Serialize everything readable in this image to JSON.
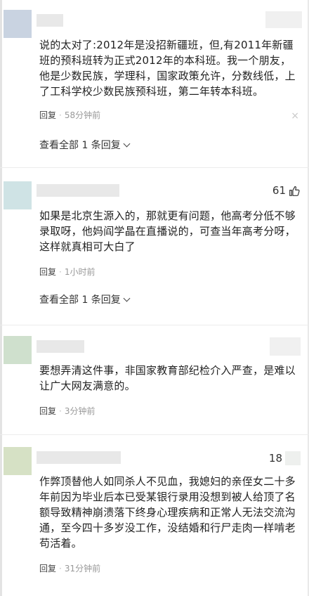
{
  "comments": [
    {
      "avatar_color": "#c9d3e1",
      "text": "说的太对了:2012年是没招新疆班，但,有2011年新疆班的预科班转为正式2012年的本科班。我一个朋友，他是少数民族，学理科，国家政策允许，分数线低，上了工科学校少数民族预科班，第二年转本科班。",
      "reply": "回复",
      "time": "58分钟前",
      "view_all": "查看全部 1 条回复"
    },
    {
      "avatar_color": "#cfe3e5",
      "likes": "61",
      "text": "如果是北京生源入的，那就更有问题，他高考分低不够录取呀，他妈阎学晶在直播说的，可查当年高考分呀，这样就真相可大白了",
      "reply": "回复",
      "time": "1小时前",
      "view_all": "查看全部 1 条回复"
    },
    {
      "avatar_color": "#cfe0cd",
      "text": "要想弄清这件事，非国家教育部纪检介入严查，是难以让广大网友满意的。",
      "reply": "回复",
      "time": "3分钟前"
    },
    {
      "avatar_color": "#d6e1c5",
      "likes": "18",
      "text": "作弊顶替他人如同杀人不见血，我媳妇的亲侄女二十多年前因为毕业后本已受某银行录用没想到被人给顶了名额导致精神崩溃落下终身心理疾病和正常人无法交流沟通，至今四十多岁没工作，没结婚和行尸走肉一样啃老苟活着。",
      "reply": "回复",
      "time": "31分钟前"
    }
  ],
  "close_glyph": "×"
}
